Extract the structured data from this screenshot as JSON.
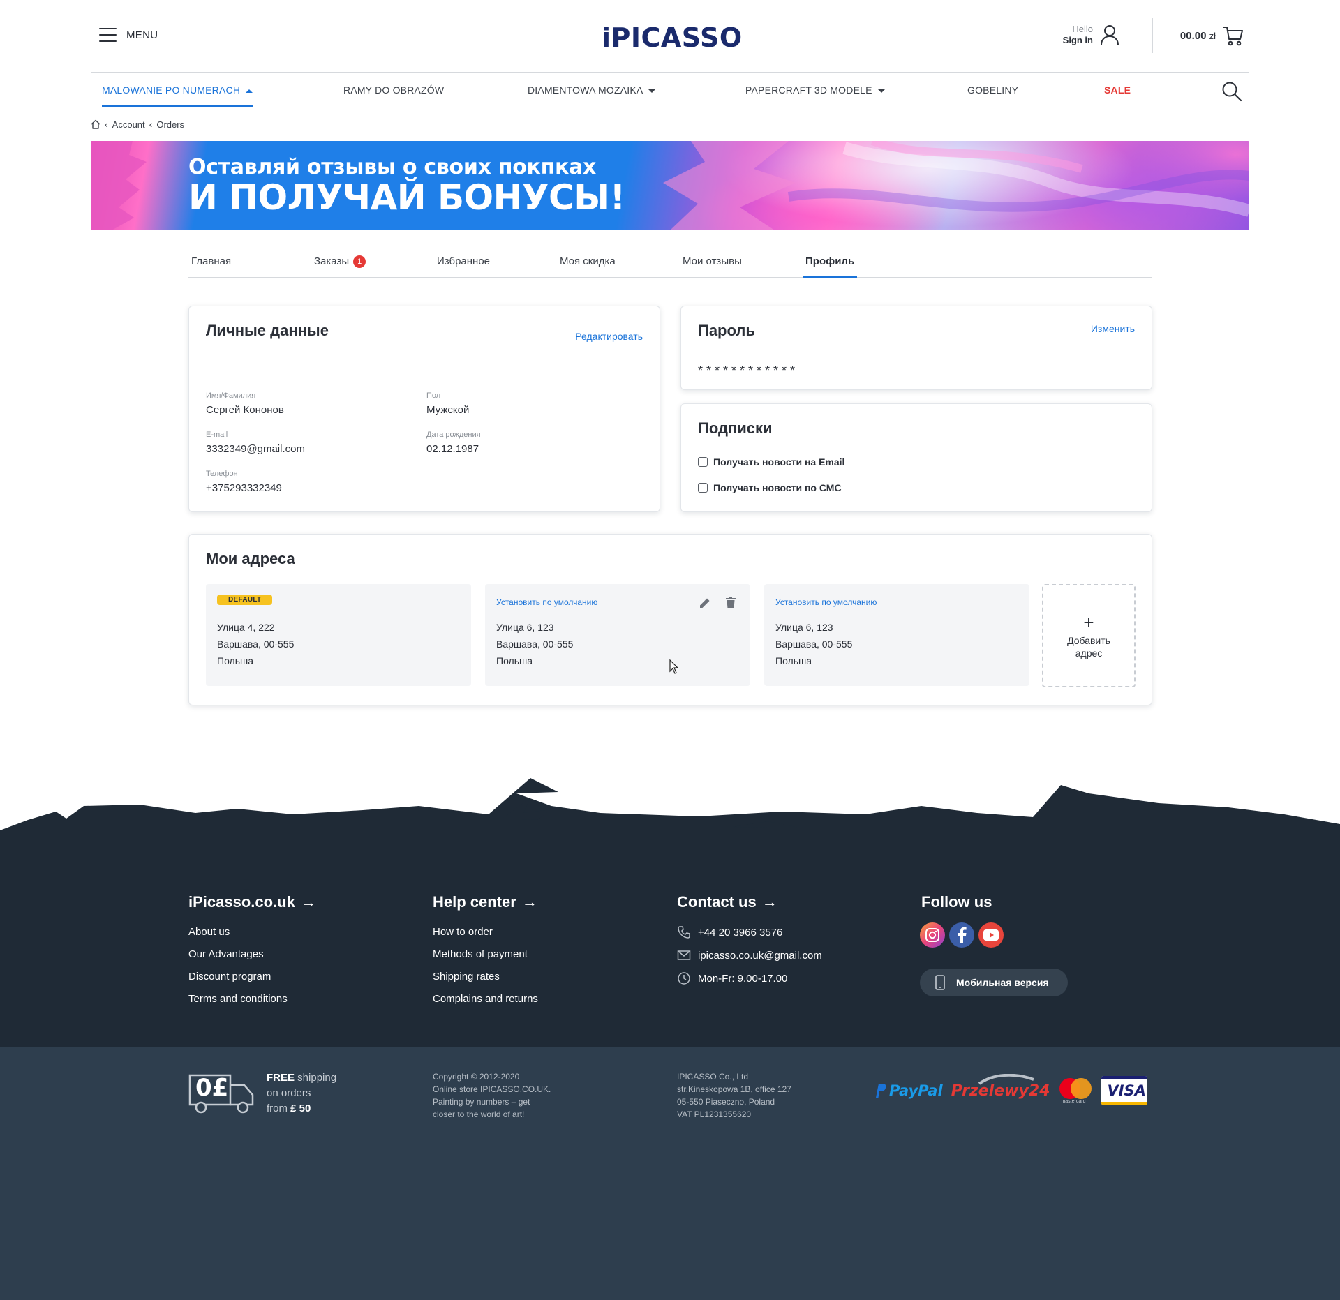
{
  "header": {
    "menu_label": "MENU",
    "logo": "iPICASSO",
    "user_hello": "Hello",
    "user_signin": "Sign in",
    "cart_amount": "00.00",
    "cart_currency": "zł"
  },
  "nav": {
    "items": [
      {
        "label": "MALOWANIE PO NUMERACH"
      },
      {
        "label": "RAMY DO OBRAZÓW"
      },
      {
        "label": "DIAMENTOWA MOZAIKA"
      },
      {
        "label": "PAPERCRAFT 3D MODELE"
      },
      {
        "label": "GOBELINY"
      },
      {
        "label": "SALE"
      }
    ]
  },
  "breadcrumb": [
    "Account",
    "Orders"
  ],
  "banner": {
    "line1": "Оставляй отзывы о своих покпках",
    "line2": "И ПОЛУЧАЙ БОНУСЫ!"
  },
  "tabs": [
    {
      "label": "Главная"
    },
    {
      "label": "Заказы",
      "badge": "1"
    },
    {
      "label": "Избранное"
    },
    {
      "label": "Моя скидка"
    },
    {
      "label": "Мои отзывы"
    },
    {
      "label": "Профиль"
    }
  ],
  "personal": {
    "title": "Личные данные",
    "edit": "Редактировать",
    "name_label": "Имя/Фамилия",
    "name": "Сергей Кононов",
    "gender_label": "Пол",
    "gender": "Мужской",
    "email_label": "E-mail",
    "email": "3332349@gmail.com",
    "birth_label": "Дата рождения",
    "birth": "02.12.1987",
    "phone_label": "Телефон",
    "phone": "+375293332349"
  },
  "password": {
    "title": "Пароль",
    "change": "Изменить",
    "mask": "************"
  },
  "subscriptions": {
    "title": "Подписки",
    "email": "Получать новости на Email",
    "sms": "Получать новости по СМС"
  },
  "addresses": {
    "title": "Мои адреса",
    "default_badge": "DEFAULT",
    "set_default": "Установить по умолчанию",
    "add_line1": "Добавить",
    "add_line2": "адрес",
    "items": [
      {
        "street": "Улица 4, 222",
        "city": "Варшава, 00-555",
        "country": "Польша"
      },
      {
        "street": "Улица 6, 123",
        "city": "Варшава, 00-555",
        "country": "Польша"
      },
      {
        "street": "Улица 6, 123",
        "city": "Варшава, 00-555",
        "country": "Польша"
      }
    ]
  },
  "footer": {
    "col1": {
      "title": "iPicasso.co.uk",
      "links": [
        "About us",
        "Our Advantages",
        "Discount program",
        "Terms and conditions"
      ]
    },
    "col2": {
      "title": "Help center",
      "links": [
        "How to order",
        "Methods of payment",
        "Shipping rates",
        "Complains and returns"
      ]
    },
    "col3": {
      "title": "Contact us",
      "phone": "+44 20 3966 3576",
      "email": "ipicasso.co.uk@gmail.com",
      "hours": "Mon-Fr: 9.00-17.00"
    },
    "col4": {
      "title": "Follow us",
      "mobile": "Мобильная версия"
    },
    "shipping": {
      "icon_value": "0£",
      "free": "FREE",
      "line1": " shipping",
      "line2": "on orders",
      "line3_pre": "from ",
      "line3_amount": "£ 50"
    },
    "copyright": [
      "Copyright © 2012-2020",
      "Online store IPICASSO.CO.UK.",
      "Painting by numbers – get",
      "closer to the world of art!"
    ],
    "company": [
      "IPICASSO Co., Ltd",
      "str.Kineskopowa 1B, office 127",
      "05-550 Piaseczno, Poland",
      "VAT PL1231355620"
    ],
    "payments": {
      "paypal": "PayPal",
      "p24": "Przelewy24",
      "mc": "mastercard",
      "visa": "VISA"
    }
  },
  "colors": {
    "accent": "#1a73d9",
    "sale": "#e53935",
    "footer_dark": "#1f2a36",
    "footer_bottom": "#2e3e4e",
    "default_badge": "#f6c220"
  }
}
